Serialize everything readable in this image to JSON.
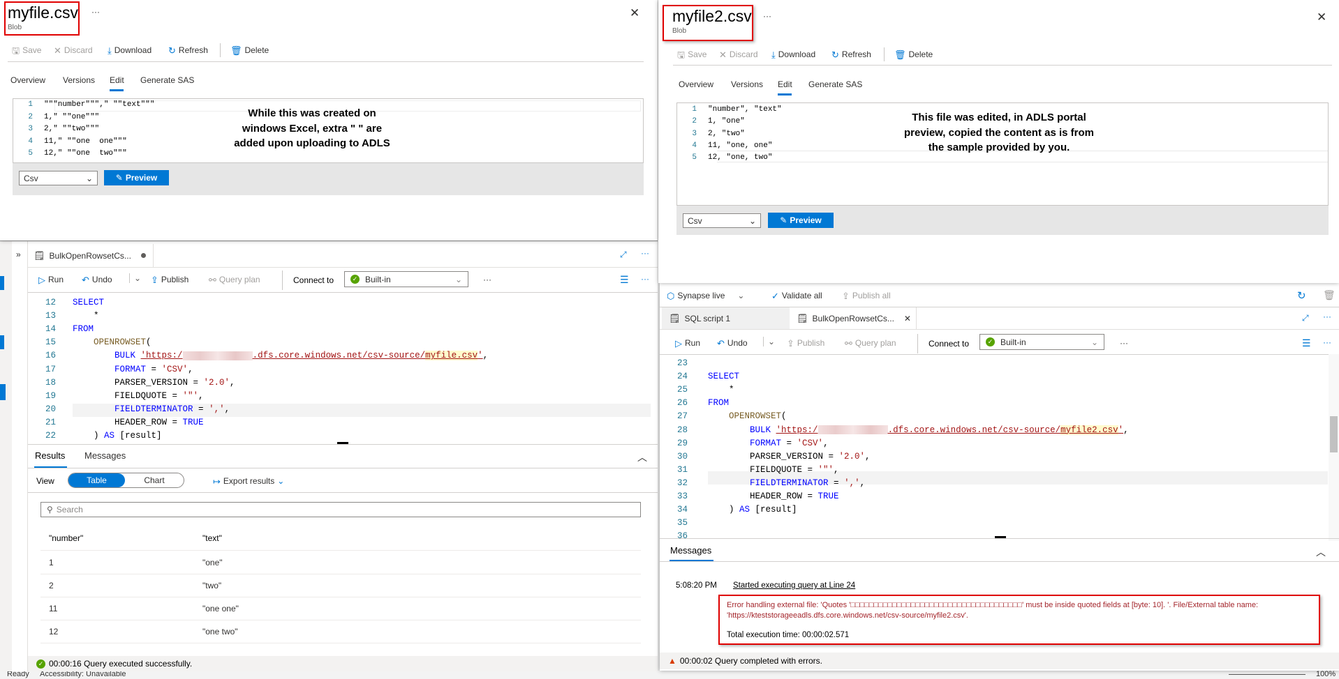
{
  "left_blob": {
    "title": "myfile.csv",
    "subtitle": "Blob",
    "more": "···",
    "toolbar": {
      "save": "Save",
      "discard": "Discard",
      "download": "Download",
      "refresh": "Refresh",
      "delete": "Delete"
    },
    "tabs": [
      "Overview",
      "Versions",
      "Edit",
      "Generate SAS"
    ],
    "active_tab": "Edit",
    "lines": [
      "\"\"\"number\"\"\",\" \"\"text\"\"\"",
      "1,\" \"\"one\"\"\"",
      "2,\" \"\"two\"\"\"",
      "11,\" \"\"one  one\"\"\"",
      "12,\" \"\"one  two\"\"\""
    ],
    "annotation": [
      "While this was created on",
      "windows Excel, extra \" \" are",
      "added upon uploading to ADLS"
    ],
    "format": "Csv",
    "preview": "Preview"
  },
  "right_blob": {
    "title": "myfile2.csv",
    "subtitle": "Blob",
    "more": "···",
    "toolbar": {
      "save": "Save",
      "discard": "Discard",
      "download": "Download",
      "refresh": "Refresh",
      "delete": "Delete"
    },
    "tabs": [
      "Overview",
      "Versions",
      "Edit",
      "Generate SAS"
    ],
    "active_tab": "Edit",
    "lines": [
      "\"number\", \"text\"",
      "1, \"one\"",
      "2, \"two\"",
      "11, \"one, one\"",
      "12, \"one, two\""
    ],
    "annotation": [
      "This file was edited, in ADLS portal",
      "preview, copied the content as is from",
      "the sample provided by you."
    ],
    "format": "Csv",
    "preview": "Preview"
  },
  "left_synapse": {
    "expand": "»",
    "tab": "BulkOpenRowsetCs...",
    "toolbar": {
      "run": "Run",
      "undo": "Undo",
      "publish": "Publish",
      "query_plan": "Query plan",
      "connect_to": "Connect to",
      "pool": "Built-in",
      "more": "···"
    },
    "code_start": 12,
    "code": [
      [
        [
          "kw",
          "SELECT"
        ]
      ],
      [
        [
          "p",
          "    *"
        ]
      ],
      [
        [
          "kw",
          "FROM"
        ]
      ],
      [
        [
          "p",
          "    "
        ],
        [
          "fn",
          "OPENROWSET"
        ],
        [
          "p",
          "("
        ]
      ],
      [
        [
          "p",
          "        "
        ],
        [
          "kw",
          "BULK"
        ],
        [
          "p",
          " "
        ],
        [
          "url",
          "'https:/"
        ],
        [
          "blur",
          ""
        ],
        [
          "url",
          ".dfs.core.windows.net/csv-source/"
        ],
        [
          "hl",
          "myfile.csv"
        ],
        [
          "url",
          "'"
        ],
        [
          "p",
          ","
        ]
      ],
      [
        [
          "p",
          "        "
        ],
        [
          "kw",
          "FORMAT"
        ],
        [
          "p",
          " = "
        ],
        [
          "str",
          "'CSV'"
        ],
        [
          "p",
          ","
        ]
      ],
      [
        [
          "p",
          "        PARSER_VERSION = "
        ],
        [
          "str",
          "'2.0'"
        ],
        [
          "p",
          ","
        ]
      ],
      [
        [
          "p",
          "        FIELDQUOTE = "
        ],
        [
          "str",
          "'\"'"
        ],
        [
          "p",
          ","
        ]
      ],
      [
        [
          "p",
          "        "
        ],
        [
          "kw",
          "FIELDTERMINATOR"
        ],
        [
          "p",
          " = "
        ],
        [
          "str",
          "','"
        ],
        [
          "p",
          ","
        ]
      ],
      [
        [
          "p",
          "        HEADER_ROW = "
        ],
        [
          "kw",
          "TRUE"
        ]
      ],
      [
        [
          "p",
          "    ) "
        ],
        [
          "kw",
          "AS"
        ],
        [
          "p",
          " [result]"
        ]
      ]
    ],
    "highlight_line": 20,
    "results_tabs": [
      "Results",
      "Messages"
    ],
    "view_label": "View",
    "view_options": [
      "Table",
      "Chart"
    ],
    "view_selected": "Table",
    "export": "Export results",
    "search_placeholder": "Search",
    "table": {
      "columns": [
        "\"number\"",
        "\"text\""
      ],
      "rows": [
        [
          "1",
          "\"one\""
        ],
        [
          "2",
          "\"two\""
        ],
        [
          "11",
          "\"one one\""
        ],
        [
          "12",
          "\"one two\""
        ]
      ]
    },
    "status": "00:00:16 Query executed successfully."
  },
  "right_synapse": {
    "mode": "Synapse live",
    "validate_all": "Validate all",
    "publish_all": "Publish all",
    "tabs": [
      "SQL script 1",
      "BulkOpenRowsetCs..."
    ],
    "active_tab": "BulkOpenRowsetCs...",
    "toolbar": {
      "run": "Run",
      "undo": "Undo",
      "publish": "Publish",
      "query_plan": "Query plan",
      "connect_to": "Connect to",
      "pool": "Built-in",
      "more": "···"
    },
    "code_start": 23,
    "code": [
      [
        [
          "p",
          ""
        ]
      ],
      [
        [
          "kw",
          "SELECT"
        ]
      ],
      [
        [
          "p",
          "    *"
        ]
      ],
      [
        [
          "kw",
          "FROM"
        ]
      ],
      [
        [
          "p",
          "    "
        ],
        [
          "fn",
          "OPENROWSET"
        ],
        [
          "p",
          "("
        ]
      ],
      [
        [
          "p",
          "        "
        ],
        [
          "kw",
          "BULK"
        ],
        [
          "p",
          " "
        ],
        [
          "url",
          "'https:/"
        ],
        [
          "blur",
          ""
        ],
        [
          "url",
          ".dfs.core.windows.net/csv-source/"
        ],
        [
          "hl",
          "myfile2.csv"
        ],
        [
          "url",
          "'"
        ],
        [
          "p",
          ","
        ]
      ],
      [
        [
          "p",
          "        "
        ],
        [
          "kw",
          "FORMAT"
        ],
        [
          "p",
          " = "
        ],
        [
          "str",
          "'CSV'"
        ],
        [
          "p",
          ","
        ]
      ],
      [
        [
          "p",
          "        PARSER_VERSION = "
        ],
        [
          "str",
          "'2.0'"
        ],
        [
          "p",
          ","
        ]
      ],
      [
        [
          "p",
          "        FIELDQUOTE = "
        ],
        [
          "str",
          "'\"'"
        ],
        [
          "p",
          ","
        ]
      ],
      [
        [
          "p",
          "        "
        ],
        [
          "kw",
          "FIELDTERMINATOR"
        ],
        [
          "p",
          " = "
        ],
        [
          "str",
          "','"
        ],
        [
          "p",
          ","
        ]
      ],
      [
        [
          "p",
          "        HEADER_ROW = "
        ],
        [
          "kw",
          "TRUE"
        ]
      ],
      [
        [
          "p",
          "    ) "
        ],
        [
          "kw",
          "AS"
        ],
        [
          "p",
          " [result]"
        ]
      ],
      [
        [
          "p",
          ""
        ]
      ],
      [
        [
          "p",
          ""
        ]
      ]
    ],
    "highlight_line": 32,
    "messages_tab": "Messages",
    "message_time": "5:08:20 PM",
    "message_link": "Started executing query at Line 24",
    "error_line1": "Error handling external file: 'Quotes '□□□□□□□□□□□□□□□□□□□□□□□□□□□□□□□□□□□□□' must be inside quoted fields at [byte: 10]. '. File/External table name:",
    "error_line2": "'https://kteststorageeadls.dfs.core.windows.net/csv-source/myfile2.csv'.",
    "exec_time": "Total execution time: 00:00:02.571",
    "status": "00:00:02 Query completed with errors."
  },
  "os_status": {
    "ready": "Ready",
    "accessibility": "Accessibility: Unavailable",
    "zoom": "100%"
  },
  "colors": {
    "accent": "#0078d4",
    "annotation_box": "#e00000",
    "error_text": "#a4262c",
    "success": "#57a300",
    "warning": "#d83b01"
  }
}
